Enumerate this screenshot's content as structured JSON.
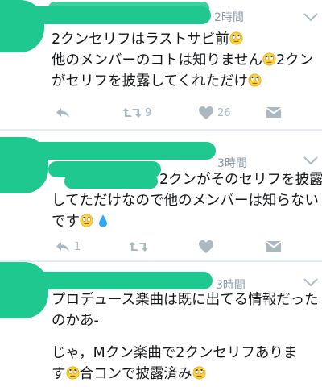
{
  "tweets": [
    {
      "time": "2時間",
      "lines": [
        "2クンセリフはラストサビ前",
        "他のメンバーのコトは知りません",
        "2クン",
        "がセリフを披露してくれただけ"
      ],
      "actions": {
        "retweets": "9",
        "likes": "26"
      }
    },
    {
      "time": "3時間",
      "lines": [
        "2クンがそのセリフを披露",
        "してただけなので他のメンバーは知らない",
        "です"
      ],
      "actions": {
        "replies": "1"
      }
    },
    {
      "time": "3時間",
      "lines": [
        "プロデュース楽曲は既に出てる情報だった",
        "のかあ-",
        "じゃ，Mクン楽曲で2クンセリフありま",
        "す",
        "合コンで披露済み"
      ]
    }
  ],
  "colors": {
    "mask": "#1ec88f",
    "icon": "#aab8c2",
    "time": "#8899a6",
    "text": "#14171a"
  },
  "icons": [
    "reply-icon",
    "retweet-icon",
    "like-icon",
    "message-icon",
    "chevron-down-icon",
    "rolling-eyes-emoji",
    "droplet-emoji"
  ]
}
